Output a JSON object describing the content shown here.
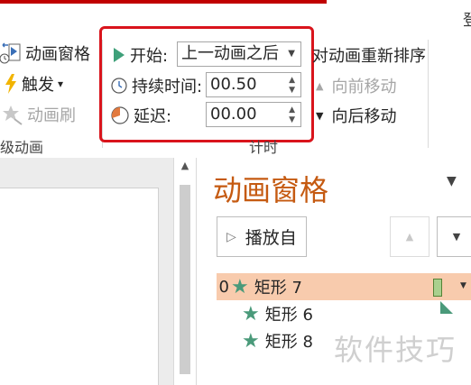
{
  "ribbon": {
    "tab_cut": "登",
    "advanced_group": {
      "anim_pane_label": "动画窗格",
      "trigger_label": "触发",
      "trigger_arrow": "▾",
      "painter_label": "动画刷",
      "group_label": "级动画"
    },
    "timing_group": {
      "start_label": "开始:",
      "start_value": "上一动画之后",
      "duration_label": "持续时间:",
      "duration_value": "00.50",
      "delay_label": "延迟:",
      "delay_value": "00.00",
      "group_label": "计时"
    },
    "reorder_group": {
      "title": "对动画重新排序",
      "move_earlier": "向前移动",
      "move_later": "向后移动"
    }
  },
  "pane": {
    "title": "动画窗格",
    "play_label": "播放自",
    "items": [
      {
        "num": "0",
        "name": "矩形 7",
        "selected": true
      },
      {
        "num": "",
        "name": "矩形 6",
        "selected": false
      },
      {
        "num": "",
        "name": "矩形 8",
        "selected": false
      }
    ]
  },
  "watermark": "软件技巧",
  "colors": {
    "accent_red": "#d9141c",
    "pane_title": "#c55a11",
    "selected_row": "#f8cbad",
    "star_green": "#4a9a7a",
    "timeline_bar": "#a9d08e"
  }
}
